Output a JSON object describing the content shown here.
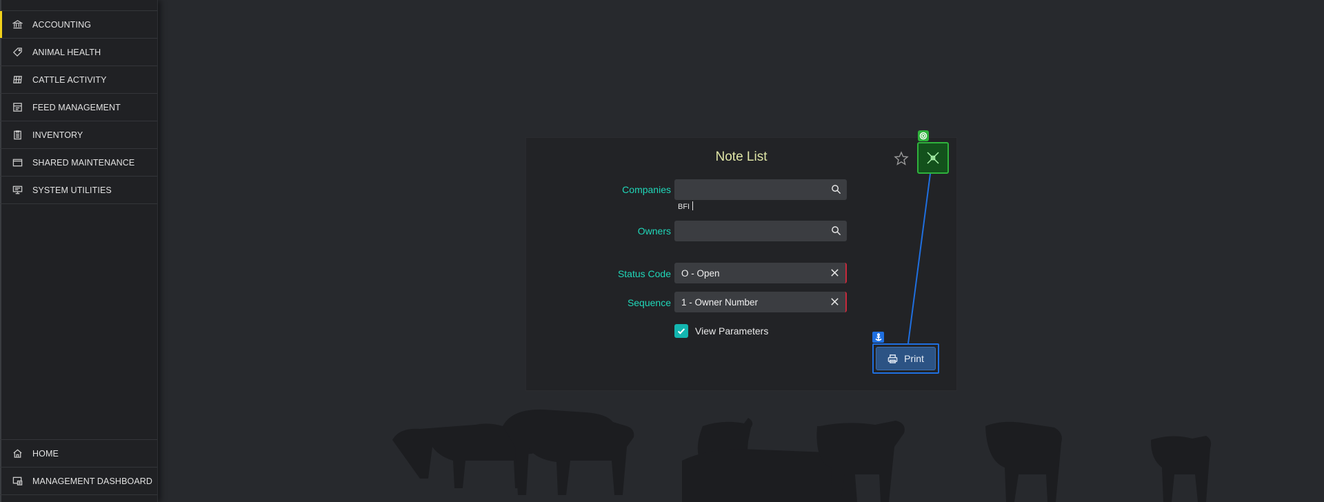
{
  "sidebar": {
    "top_items": [
      {
        "label": "ACCOUNTING",
        "icon": "bank-icon",
        "active": true
      },
      {
        "label": "ANIMAL HEALTH",
        "icon": "tag-icon"
      },
      {
        "label": "CATTLE ACTIVITY",
        "icon": "grid-table-icon"
      },
      {
        "label": "FEED MANAGEMENT",
        "icon": "store-icon"
      },
      {
        "label": "INVENTORY",
        "icon": "clipboard-icon"
      },
      {
        "label": "SHARED MAINTENANCE",
        "icon": "folder-icon"
      },
      {
        "label": "SYSTEM UTILITIES",
        "icon": "monitor-icon"
      }
    ],
    "bottom_items": [
      {
        "label": "HOME",
        "icon": "home-icon"
      },
      {
        "label": "MANAGEMENT DASHBOARD",
        "icon": "dashboard-icon"
      }
    ],
    "accent_color": "#f2d21b"
  },
  "dialog": {
    "title": "Note List",
    "companies": {
      "label": "Companies",
      "value": "",
      "typed_text": "BFI"
    },
    "owners": {
      "label": "Owners",
      "value": ""
    },
    "status_code": {
      "label": "Status Code",
      "value": "O - Open"
    },
    "sequence": {
      "label": "Sequence",
      "value": "1 - Owner Number"
    },
    "view_parameters": {
      "label": "View Parameters",
      "checked": true
    },
    "print_label": "Print"
  },
  "colors": {
    "label_teal": "#20d7b9",
    "title_yellow": "#dfe5a6",
    "required_red": "#c82a3c",
    "checkbox_teal": "#13b6b0",
    "annotation_blue": "#1f6fe0",
    "annotation_green": "#2fb33c"
  }
}
